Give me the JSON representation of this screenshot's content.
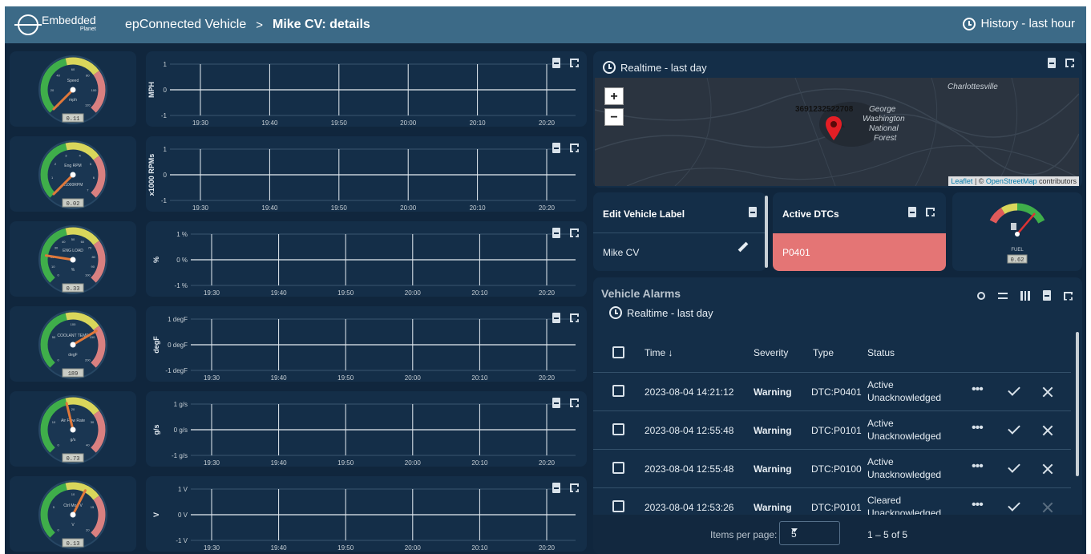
{
  "header": {
    "logo_text": "Embedded",
    "logo_sub": "Planet",
    "breadcrumb_root": "epConnected Vehicle",
    "breadcrumb_sep": ">",
    "breadcrumb_current": "Mike CV: details",
    "history": "History - last hour"
  },
  "gauges": [
    {
      "label": "Speed",
      "unit": "mph",
      "value": "0.11",
      "needle": 0.0,
      "scale": [
        "0",
        "20",
        "40",
        "60",
        "80",
        "100",
        "120"
      ]
    },
    {
      "label": "Eng RPM",
      "unit": "x1000RPM",
      "value": "0.02",
      "needle": 0.0,
      "scale": [
        "0",
        "1",
        "2",
        "3",
        "4",
        "5",
        "6",
        "7"
      ]
    },
    {
      "label": "ENG LOAD",
      "unit": "%",
      "value": "0.33",
      "needle": 0.2,
      "scale": [
        "0",
        "10",
        "20",
        "30",
        "40",
        "50",
        "60",
        "70",
        "80",
        "90",
        "100"
      ]
    },
    {
      "label": "COOLANT TEMP",
      "unit": "degF",
      "value": "189",
      "needle": 0.72,
      "scale": [
        "0",
        "50",
        "100",
        "150",
        "200"
      ]
    },
    {
      "label": "Air Flow Rate",
      "unit": "g/s",
      "value": "0.73",
      "needle": 0.45,
      "scale": [
        "0",
        "10",
        "20",
        "30",
        "40"
      ]
    },
    {
      "label": "Ctrl Mod V",
      "unit": "V",
      "value": "0.13",
      "needle": 0.6,
      "scale": [
        "0",
        "5",
        "10",
        "15",
        "20"
      ]
    }
  ],
  "charts": [
    {
      "ylabel": "MPH",
      "yticks": [
        "1",
        "0",
        "-1"
      ]
    },
    {
      "ylabel": "x1000 RPMs",
      "yticks": [
        "1",
        "0",
        "-1"
      ]
    },
    {
      "ylabel": "%",
      "yticks": [
        "1 %",
        "0 %",
        "-1 %"
      ]
    },
    {
      "ylabel": "degF",
      "yticks": [
        "1 degF",
        "0 degF",
        "-1 degF"
      ]
    },
    {
      "ylabel": "g/s",
      "yticks": [
        "1 g/s",
        "0 g/s",
        "-1 g/s"
      ]
    },
    {
      "ylabel": "V",
      "yticks": [
        "1 V",
        "0 V",
        "-1 V"
      ]
    }
  ],
  "chart_times": [
    "19:30",
    "19:40",
    "19:50",
    "20:00",
    "20:10",
    "20:20"
  ],
  "map": {
    "title": "Realtime - last day",
    "zoom_in": "+",
    "zoom_out": "−",
    "place_1": "Charlottesville",
    "place_2": "George",
    "place_3": "Washington",
    "place_4": "National",
    "place_5": "Forest",
    "marker_text": "3691232522708",
    "attr_leaflet": "Leaflet",
    "attr_sep": " | © ",
    "attr_osm": "OpenStreetMap",
    "attr_tail": " contributors"
  },
  "vehicle_label": {
    "title": "Edit Vehicle Label",
    "value": "Mike CV"
  },
  "dtcs": {
    "title": "Active DTCs",
    "items": [
      "P0401"
    ]
  },
  "fuel": {
    "label": "FUEL",
    "value": "0.62",
    "level": 0.82
  },
  "alarms": {
    "title": "Vehicle Alarms",
    "subtitle": "Realtime - last day",
    "columns": {
      "time": "Time ↓",
      "severity": "Severity",
      "type": "Type",
      "status": "Status"
    },
    "rows": [
      {
        "time": "2023-08-04 14:21:12",
        "severity": "Warning",
        "type": "DTC:P0401",
        "status1": "Active",
        "status2": "Unacknowledged"
      },
      {
        "time": "2023-08-04 12:55:48",
        "severity": "Warning",
        "type": "DTC:P0101",
        "status1": "Active",
        "status2": "Unacknowledged"
      },
      {
        "time": "2023-08-04 12:55:48",
        "severity": "Warning",
        "type": "DTC:P0100",
        "status1": "Active",
        "status2": "Unacknowledged"
      },
      {
        "time": "2023-08-04 12:53:26",
        "severity": "Warning",
        "type": "DTC:P0101",
        "status1": "Cleared",
        "status2": "Unacknowledged"
      }
    ],
    "pager": {
      "label": "Items per page:",
      "page_size": "5",
      "range": "1 – 5 of 5"
    }
  },
  "colors": {
    "bg": "#10263d",
    "card": "#142e48",
    "topbar": "#3c6a87",
    "dtc_active": "#e47575"
  }
}
